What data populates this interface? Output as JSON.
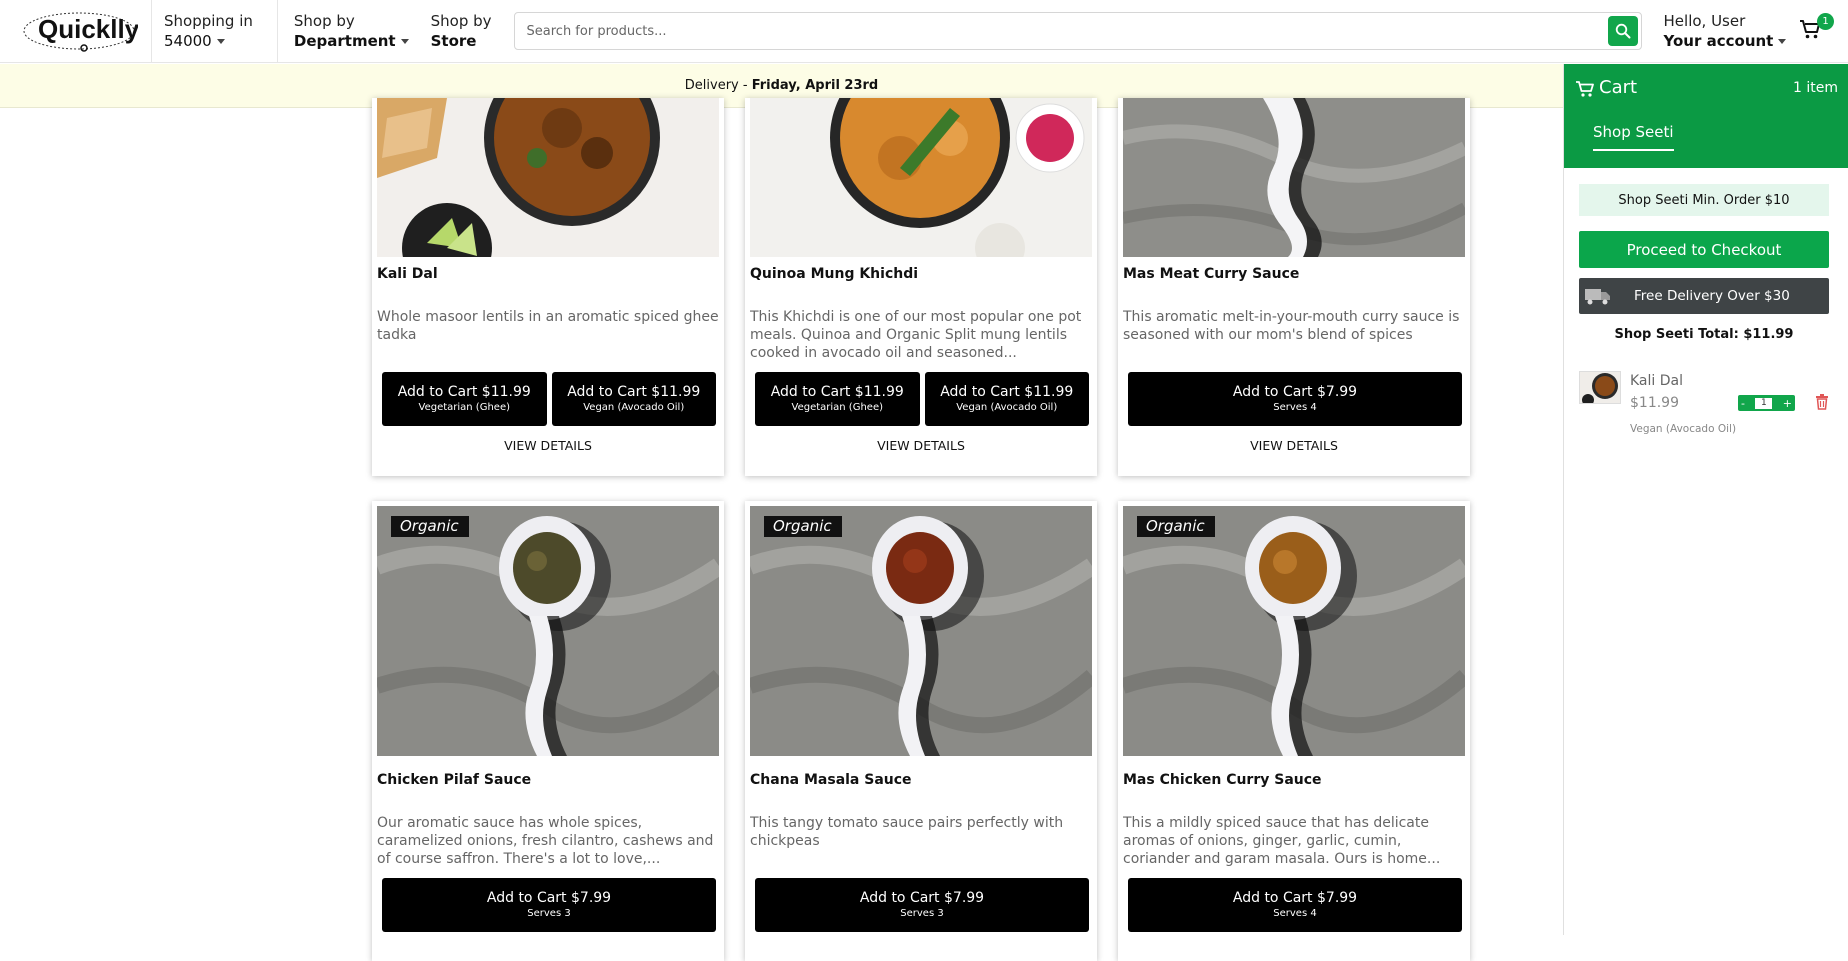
{
  "header": {
    "logo_text": "Quicklly",
    "shopping_in_label": "Shopping in",
    "zip": "54000",
    "shop_by_dept_label": "Shop by",
    "shop_by_dept_value": "Department",
    "shop_by_store_label": "Shop by",
    "shop_by_store_value": "Store",
    "search_placeholder": "Search for products...",
    "greeting": "Hello, User",
    "account_label": "Your account",
    "cart_count": "1",
    "search_icon": "search-icon",
    "cart_icon": "shopping-cart-icon"
  },
  "delivery": {
    "prefix": "Delivery - ",
    "date": "Friday, April 23rd"
  },
  "products": [
    {
      "title": "Kali Dal",
      "description": "Whole masoor lentils in an aromatic spiced ghee tadka",
      "buttons": [
        {
          "price": "Add to Cart $11.99",
          "variant": "Vegetarian (Ghee)"
        },
        {
          "price": "Add to Cart $11.99",
          "variant": "Vegan (Avocado Oil)"
        }
      ],
      "details": "VIEW DETAILS"
    },
    {
      "title": "Quinoa Mung Khichdi",
      "description": "This Khichdi is one of our most popular one pot meals. Quinoa and Organic Split mung lentils cooked in avocado oil and seasoned...",
      "buttons": [
        {
          "price": "Add to Cart $11.99",
          "variant": "Vegetarian (Ghee)"
        },
        {
          "price": "Add to Cart $11.99",
          "variant": "Vegan (Avocado Oil)"
        }
      ],
      "details": "VIEW DETAILS"
    },
    {
      "title": "Mas Meat Curry Sauce",
      "description": "This aromatic melt-in-your-mouth curry sauce is seasoned with our mom's blend of spices",
      "buttons": [
        {
          "price": "Add to Cart $7.99",
          "variant": "Serves 4"
        }
      ],
      "details": "VIEW DETAILS"
    },
    {
      "badge": "Organic",
      "title": "Chicken Pilaf Sauce",
      "description": "Our aromatic sauce has whole spices, caramelized onions, fresh cilantro, cashews and of course saffron. There's a lot to love,...",
      "buttons": [
        {
          "price": "Add to Cart $7.99",
          "variant": "Serves 3"
        }
      ]
    },
    {
      "badge": "Organic",
      "title": "Chana Masala Sauce",
      "description": "This tangy tomato sauce pairs perfectly with chickpeas",
      "buttons": [
        {
          "price": "Add to Cart $7.99",
          "variant": "Serves 3"
        }
      ]
    },
    {
      "badge": "Organic",
      "title": "Mas Chicken Curry Sauce",
      "description": "This a mildly spiced sauce that has delicate aromas of onions, ginger, garlic, cumin, coriander and garam masala. Ours is home...",
      "buttons": [
        {
          "price": "Add to Cart $7.99",
          "variant": "Serves 4"
        }
      ]
    }
  ],
  "cart": {
    "title": "Cart",
    "item_count": "1 item",
    "store_tab": "Shop Seeti",
    "min_order": "Shop Seeti Min. Order $10",
    "checkout": "Proceed to Checkout",
    "free_delivery": "Free Delivery Over $30",
    "total": "Shop Seeti Total: $11.99",
    "item": {
      "name": "Kali Dal",
      "price": "$11.99",
      "variant": "Vegan (Avocado Oil)",
      "qty": "1",
      "minus": "-",
      "plus": "+"
    }
  },
  "colors": {
    "brand_green": "#0b9a44",
    "button_black": "#000000",
    "delivery_bar": "#fdfde6"
  }
}
